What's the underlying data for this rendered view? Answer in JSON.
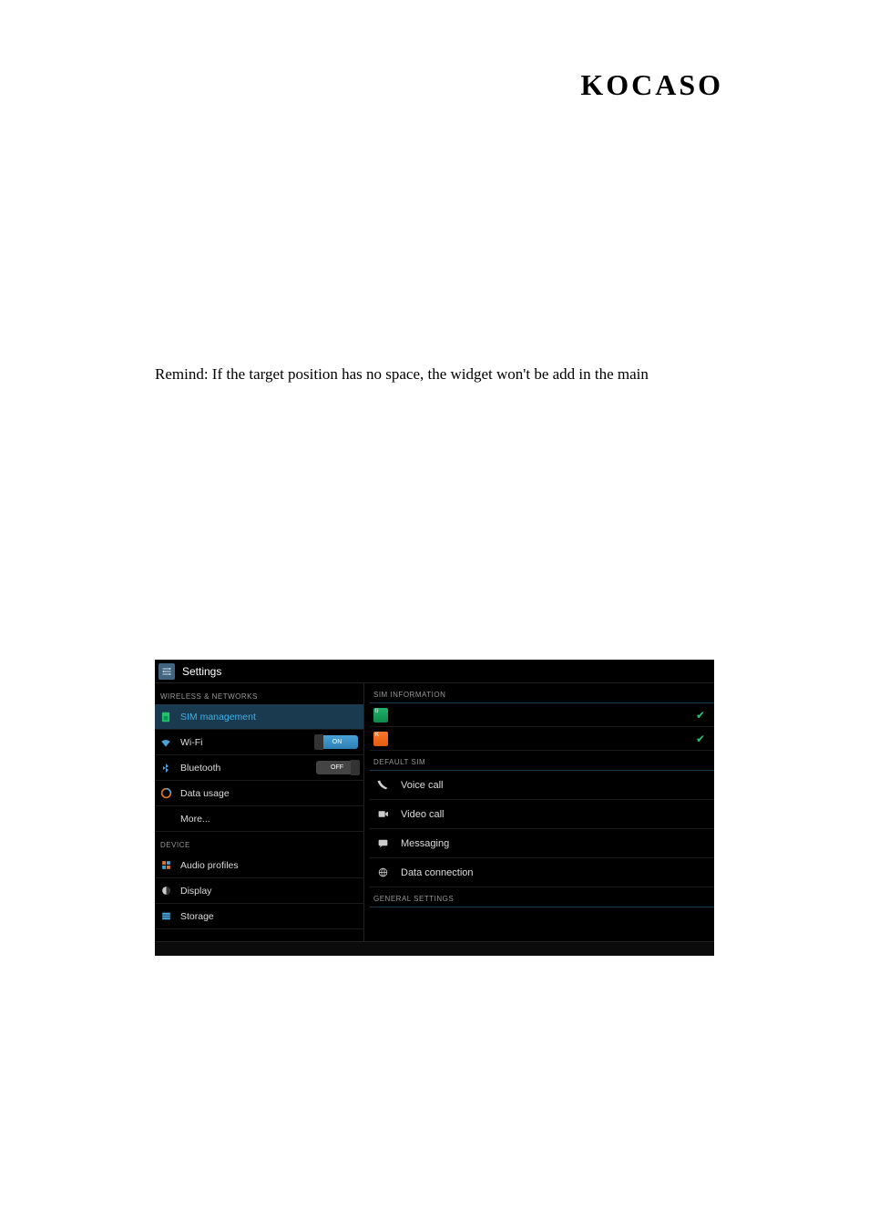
{
  "brand": "KOCASO",
  "remind": "Remind: If the target position has no space, the widget won't be add in the main",
  "screenshot": {
    "title": "Settings",
    "sidebar": {
      "section_wireless": "WIRELESS & NETWORKS",
      "section_device": "DEVICE",
      "items": {
        "sim_management": "SIM management",
        "wifi": "Wi-Fi",
        "wifi_toggle": "ON",
        "bluetooth": "Bluetooth",
        "bluetooth_toggle": "OFF",
        "data_usage": "Data usage",
        "more": "More...",
        "audio_profiles": "Audio profiles",
        "display": "Display",
        "storage": "Storage"
      }
    },
    "content": {
      "section_sim_info": "SIM INFORMATION",
      "section_default_sim": "DEFAULT SIM",
      "section_general": "GENERAL SETTINGS",
      "sim1_badge": "ti",
      "sim2_badge": "K",
      "items": {
        "voice_call": "Voice call",
        "video_call": "Video call",
        "messaging": "Messaging",
        "data_connection": "Data connection"
      }
    }
  }
}
